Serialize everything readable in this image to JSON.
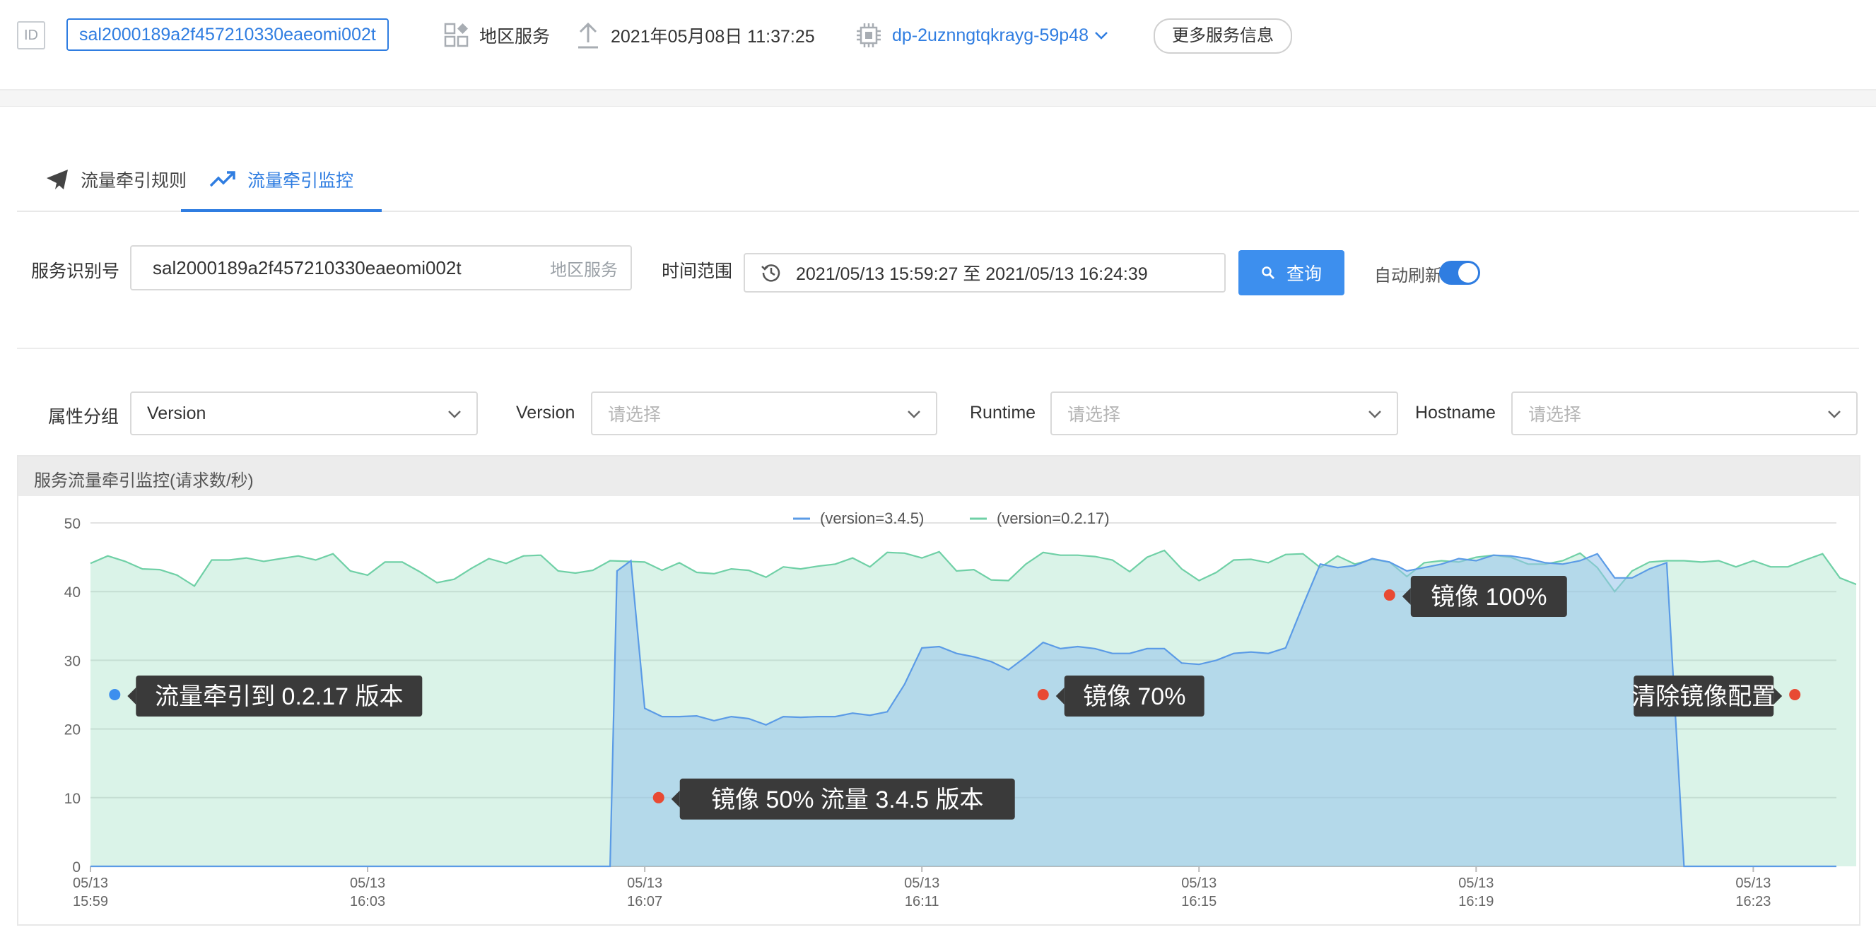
{
  "topbar": {
    "id_label": "ID",
    "service_id": "sal2000189a2f457210330eaeomi002t",
    "service_type": "地区服务",
    "datetime": "2021年05月08日 11:37:25",
    "deployment": "dp-2uznngtqkrayg-59p48",
    "more_button": "更多服务信息"
  },
  "tabs": [
    {
      "label": "流量牵引规则",
      "active": false
    },
    {
      "label": "流量牵引监控",
      "active": true
    }
  ],
  "query": {
    "service_label": "服务识别号",
    "service_value": "sal2000189a2f457210330eaeomi002t",
    "service_suffix": "地区服务",
    "time_label": "时间范围",
    "time_value": "2021/05/13 15:59:27 至 2021/05/13 16:24:39",
    "search_button": "查询",
    "auto_refresh_label": "自动刷新",
    "auto_refresh_on": true
  },
  "filters": {
    "group_label": "属性分组",
    "group_value": "Version",
    "version_label": "Version",
    "version_placeholder": "请选择",
    "runtime_label": "Runtime",
    "runtime_placeholder": "请选择",
    "hostname_label": "Hostname",
    "hostname_placeholder": "请选择"
  },
  "panel": {
    "title": "服务流量牵引监控(请求数/秒)"
  },
  "colors": {
    "accent": "#2f7de1",
    "series_blue": "#5b9be6",
    "series_green": "#6fd0a6",
    "marker_red": "#e84a33",
    "marker_blue": "#3d8fee",
    "tooltip_bg": "#3a3a3a"
  },
  "chart_data": {
    "type": "area",
    "title": "服务流量牵引监控(请求数/秒)",
    "ylim": [
      0,
      50
    ],
    "yticks": [
      0,
      10,
      20,
      30,
      40,
      50
    ],
    "xlim": [
      "15:59",
      "16:24"
    ],
    "xticks": [
      {
        "date": "05/13",
        "time": "15:59"
      },
      {
        "date": "05/13",
        "time": "16:03"
      },
      {
        "date": "05/13",
        "time": "16:07"
      },
      {
        "date": "05/13",
        "time": "16:11"
      },
      {
        "date": "05/13",
        "time": "16:15"
      },
      {
        "date": "05/13",
        "time": "16:19"
      },
      {
        "date": "05/13",
        "time": "16:23"
      }
    ],
    "grid": true,
    "legend_position": "top-center",
    "series": [
      {
        "name": "(version=3.4.5)",
        "color": "#5b9be6",
        "points": [
          [
            0,
            0
          ],
          [
            7.3,
            0
          ],
          [
            7.5,
            0
          ],
          [
            7.6,
            43
          ],
          [
            7.8,
            44.5
          ],
          [
            8,
            23
          ],
          [
            8.25,
            21.8
          ],
          [
            8.5,
            21.8
          ],
          [
            8.75,
            21.9
          ],
          [
            9,
            21.2
          ],
          [
            9.25,
            21.8
          ],
          [
            9.5,
            21.5
          ],
          [
            9.75,
            20.6
          ],
          [
            10,
            21.8
          ],
          [
            10.25,
            21.7
          ],
          [
            10.5,
            21.8
          ],
          [
            10.75,
            21.8
          ],
          [
            11,
            22.3
          ],
          [
            11.25,
            22
          ],
          [
            11.5,
            22.5
          ],
          [
            11.75,
            26.5
          ],
          [
            12,
            31.8
          ],
          [
            12.25,
            32
          ],
          [
            12.5,
            31
          ],
          [
            12.75,
            30.5
          ],
          [
            13,
            29.8
          ],
          [
            13.25,
            28.6
          ],
          [
            13.5,
            30.5
          ],
          [
            13.75,
            32.6
          ],
          [
            14,
            31.7
          ],
          [
            14.25,
            32
          ],
          [
            14.5,
            31.7
          ],
          [
            14.75,
            31
          ],
          [
            15,
            31
          ],
          [
            15.25,
            31.7
          ],
          [
            15.5,
            31.7
          ],
          [
            15.75,
            29.6
          ],
          [
            16,
            29.4
          ],
          [
            16.25,
            30
          ],
          [
            16.5,
            31
          ],
          [
            16.75,
            31.2
          ],
          [
            17,
            31
          ],
          [
            17.25,
            31.8
          ],
          [
            17.5,
            38
          ],
          [
            17.75,
            44
          ],
          [
            18,
            43.5
          ],
          [
            18.25,
            43.8
          ],
          [
            18.5,
            44.8
          ],
          [
            18.75,
            44.3
          ],
          [
            19,
            43
          ],
          [
            19.25,
            43.5
          ],
          [
            19.5,
            44
          ],
          [
            19.75,
            44.8
          ],
          [
            20,
            44.5
          ],
          [
            20.25,
            45.3
          ],
          [
            20.5,
            45.2
          ],
          [
            20.75,
            44.8
          ],
          [
            21,
            44.2
          ],
          [
            21.25,
            44
          ],
          [
            21.5,
            44.5
          ],
          [
            21.75,
            45.5
          ],
          [
            22,
            42
          ],
          [
            22.25,
            42
          ],
          [
            22.5,
            43.3
          ],
          [
            22.75,
            44.2
          ],
          [
            23,
            0
          ],
          [
            23.25,
            0
          ],
          [
            25.2,
            0
          ]
        ]
      },
      {
        "name": "(version=0.2.17)",
        "color": "#6fd0a6",
        "points": [
          [
            0,
            44.1
          ],
          [
            0.25,
            45.2
          ],
          [
            0.5,
            44.4
          ],
          [
            0.75,
            43.3
          ],
          [
            1,
            43.2
          ],
          [
            1.25,
            42.4
          ],
          [
            1.5,
            40.8
          ],
          [
            1.75,
            44.6
          ],
          [
            2,
            44.6
          ],
          [
            2.25,
            44.9
          ],
          [
            2.5,
            44.4
          ],
          [
            2.75,
            44.8
          ],
          [
            3,
            45.2
          ],
          [
            3.25,
            44.6
          ],
          [
            3.5,
            45.5
          ],
          [
            3.75,
            43
          ],
          [
            4,
            42.4
          ],
          [
            4.25,
            44.3
          ],
          [
            4.5,
            44.3
          ],
          [
            4.75,
            42.9
          ],
          [
            5,
            41.3
          ],
          [
            5.25,
            41.8
          ],
          [
            5.5,
            43.4
          ],
          [
            5.75,
            44.8
          ],
          [
            6,
            44.1
          ],
          [
            6.25,
            45.2
          ],
          [
            6.5,
            45.3
          ],
          [
            6.75,
            43
          ],
          [
            7,
            42.7
          ],
          [
            7.25,
            43.1
          ],
          [
            7.5,
            44.5
          ],
          [
            7.75,
            44.4
          ],
          [
            8,
            44.3
          ],
          [
            8.25,
            43.1
          ],
          [
            8.5,
            44.2
          ],
          [
            8.75,
            42.8
          ],
          [
            9,
            42.6
          ],
          [
            9.25,
            43.3
          ],
          [
            9.5,
            43.1
          ],
          [
            9.75,
            42.1
          ],
          [
            10,
            43.6
          ],
          [
            10.25,
            43.3
          ],
          [
            10.5,
            43.7
          ],
          [
            10.75,
            44
          ],
          [
            11,
            44.9
          ],
          [
            11.25,
            43.6
          ],
          [
            11.5,
            45.7
          ],
          [
            11.75,
            45.6
          ],
          [
            12,
            44.9
          ],
          [
            12.25,
            45.8
          ],
          [
            12.5,
            43
          ],
          [
            12.75,
            43.2
          ],
          [
            13,
            41.7
          ],
          [
            13.25,
            41.6
          ],
          [
            13.5,
            44
          ],
          [
            13.75,
            45.7
          ],
          [
            14,
            45.3
          ],
          [
            14.25,
            45.3
          ],
          [
            14.5,
            45.1
          ],
          [
            14.75,
            44.6
          ],
          [
            15,
            42.9
          ],
          [
            15.25,
            45
          ],
          [
            15.5,
            46
          ],
          [
            15.75,
            43.3
          ],
          [
            16,
            41.6
          ],
          [
            16.25,
            42.8
          ],
          [
            16.5,
            44.6
          ],
          [
            16.75,
            44.7
          ],
          [
            17,
            44.2
          ],
          [
            17.25,
            45.4
          ],
          [
            17.5,
            45.5
          ],
          [
            17.75,
            43.5
          ],
          [
            18,
            45.2
          ],
          [
            18.25,
            44
          ],
          [
            18.5,
            44.7
          ],
          [
            18.75,
            44.3
          ],
          [
            19,
            42.2
          ],
          [
            19.25,
            44.2
          ],
          [
            19.5,
            44.5
          ],
          [
            19.75,
            44.3
          ],
          [
            20,
            45
          ],
          [
            20.25,
            45.3
          ],
          [
            20.5,
            45
          ],
          [
            20.75,
            44
          ],
          [
            21,
            44
          ],
          [
            21.25,
            44.5
          ],
          [
            21.5,
            45.6
          ],
          [
            21.75,
            43.5
          ],
          [
            22,
            40
          ],
          [
            22.25,
            43
          ],
          [
            22.5,
            44.3
          ],
          [
            22.75,
            44.5
          ],
          [
            23,
            44.5
          ],
          [
            23.25,
            44.3
          ],
          [
            23.5,
            44.5
          ],
          [
            23.75,
            43.6
          ],
          [
            24,
            44.5
          ],
          [
            24.25,
            43.6
          ],
          [
            24.5,
            43.6
          ],
          [
            24.75,
            44.6
          ],
          [
            25,
            45.5
          ],
          [
            25.25,
            42
          ],
          [
            25.5,
            41
          ]
        ]
      }
    ],
    "annotations": [
      {
        "text": "流量牵引到 0.2.17 版本",
        "x": 0.35,
        "y": 25,
        "marker": "blue",
        "side": "right"
      },
      {
        "text": "镜像 50% 流量 3.4.5 版本",
        "x": 8.2,
        "y": 10,
        "marker": "red",
        "side": "right"
      },
      {
        "text": "镜像 70%",
        "x": 13.75,
        "y": 25,
        "marker": "red",
        "side": "right"
      },
      {
        "text": "镜像 100%",
        "x": 18.75,
        "y": 39.5,
        "marker": "red",
        "side": "right"
      },
      {
        "text": "清除镜像配置",
        "x": 24.6,
        "y": 25,
        "marker": "red",
        "side": "left"
      }
    ]
  }
}
